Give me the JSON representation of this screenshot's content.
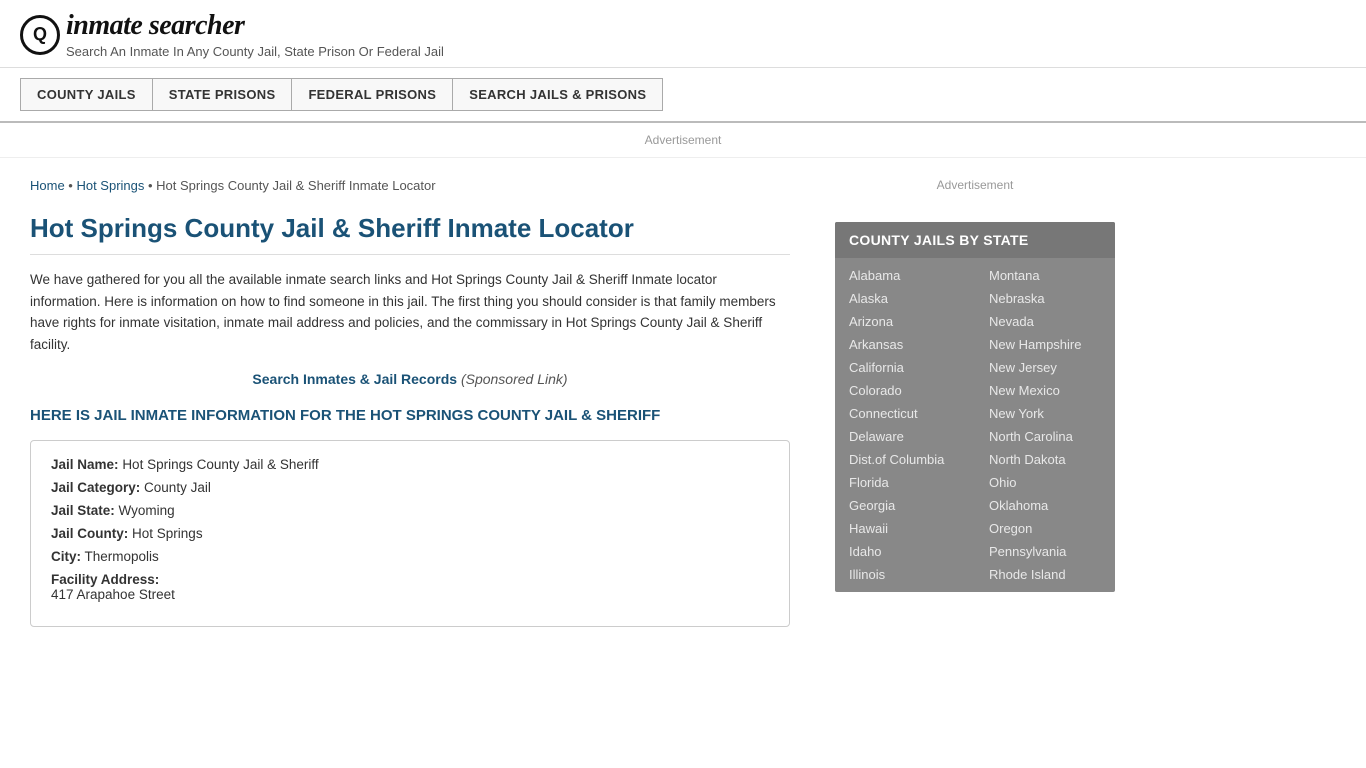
{
  "header": {
    "logo_icon": "🔍",
    "logo_text_start": "inmate",
    "logo_text_end": "searcher",
    "tagline": "Search An Inmate In Any County Jail, State Prison Or Federal Jail"
  },
  "nav": {
    "items": [
      {
        "label": "COUNTY JAILS",
        "id": "county-jails-btn"
      },
      {
        "label": "STATE PRISONS",
        "id": "state-prisons-btn"
      },
      {
        "label": "FEDERAL PRISONS",
        "id": "federal-prisons-btn"
      },
      {
        "label": "SEARCH JAILS & PRISONS",
        "id": "search-jails-btn"
      }
    ]
  },
  "ad_label": "Advertisement",
  "breadcrumb": {
    "home": "Home",
    "parent": "Hot Springs",
    "current": "Hot Springs County Jail & Sheriff Inmate Locator"
  },
  "page_title": "Hot Springs County Jail & Sheriff Inmate Locator",
  "description": "We have gathered for you all the available inmate search links and Hot Springs County Jail & Sheriff Inmate locator information. Here is information on how to find someone in this jail. The first thing you should consider is that family members have rights for inmate visitation, inmate mail address and policies, and the commissary in Hot Springs County Jail & Sheriff facility.",
  "search_link_text": "Search Inmates & Jail Records",
  "search_link_sponsored": "(Sponsored Link)",
  "sub_heading": "HERE IS JAIL INMATE INFORMATION FOR THE HOT SPRINGS COUNTY JAIL & SHERIFF",
  "jail_info": {
    "name_label": "Jail Name:",
    "name_value": "Hot Springs County Jail & Sheriff",
    "category_label": "Jail Category:",
    "category_value": "County Jail",
    "state_label": "Jail State:",
    "state_value": "Wyoming",
    "county_label": "Jail County:",
    "county_value": "Hot Springs",
    "city_label": "City:",
    "city_value": "Thermopolis",
    "address_label": "Facility Address:",
    "address_value": "417 Arapahoe Street"
  },
  "sidebar": {
    "ad_label": "Advertisement",
    "county_jails_title": "COUNTY JAILS BY STATE",
    "states_col1": [
      "Alabama",
      "Alaska",
      "Arizona",
      "Arkansas",
      "California",
      "Colorado",
      "Connecticut",
      "Delaware",
      "Dist.of Columbia",
      "Florida",
      "Georgia",
      "Hawaii",
      "Idaho",
      "Illinois"
    ],
    "states_col2": [
      "Montana",
      "Nebraska",
      "Nevada",
      "New Hampshire",
      "New Jersey",
      "New Mexico",
      "New York",
      "North Carolina",
      "North Dakota",
      "Ohio",
      "Oklahoma",
      "Oregon",
      "Pennsylvania",
      "Rhode Island"
    ]
  }
}
